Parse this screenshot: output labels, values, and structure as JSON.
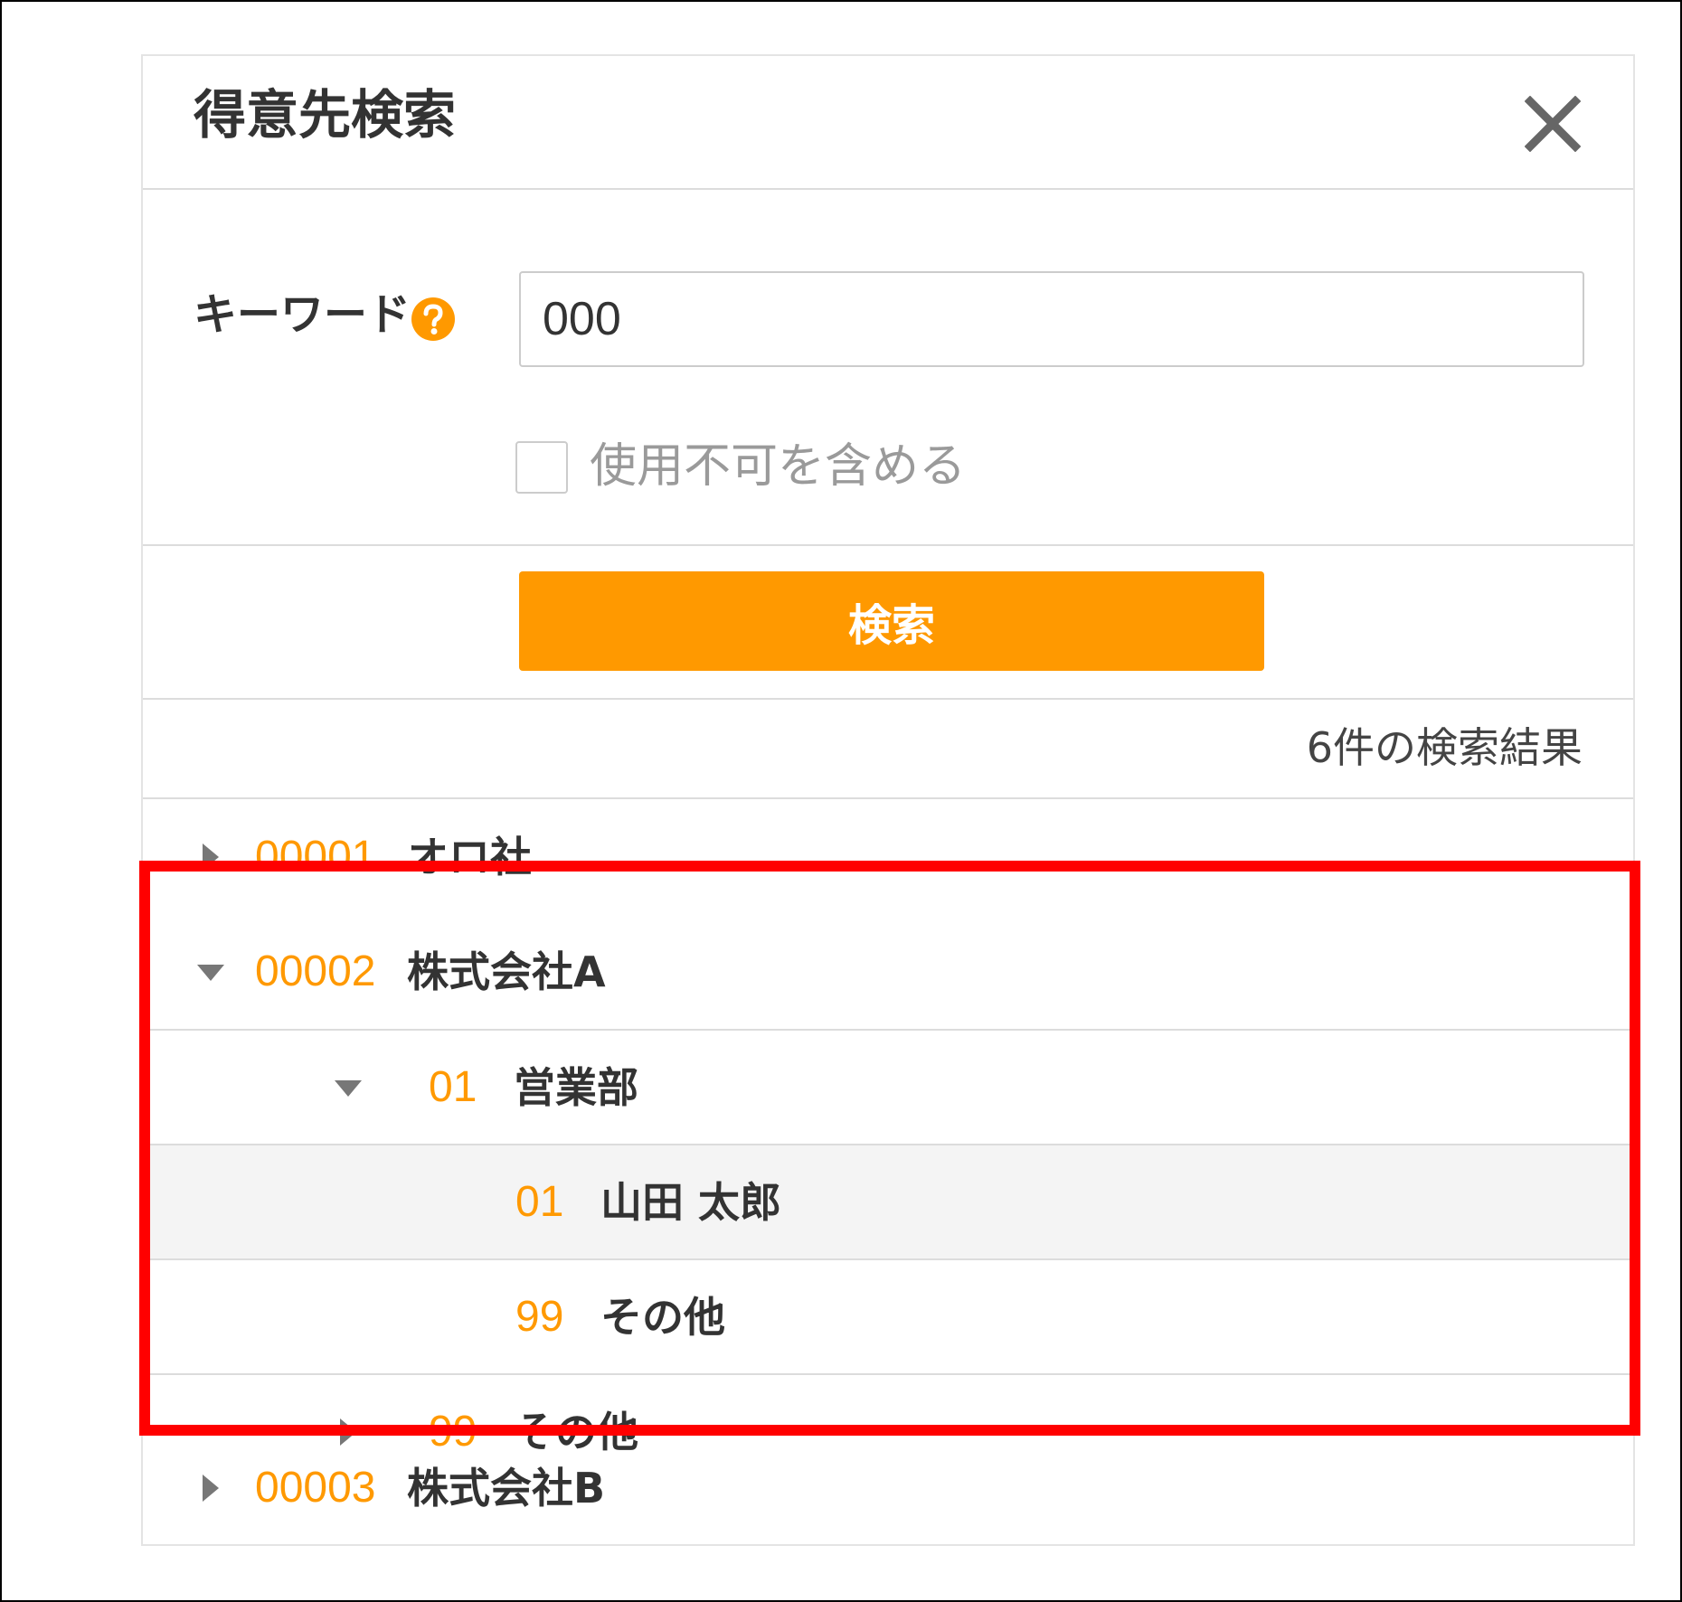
{
  "dialog": {
    "title": "得意先検索",
    "close_icon": "close-icon"
  },
  "form": {
    "keyword_label": "キーワード",
    "keyword_value": "000",
    "help_icon": "question-circle-icon",
    "include_unusable_label": "使用不可を含める",
    "include_unusable_checked": false
  },
  "actions": {
    "search_label": "検索"
  },
  "results": {
    "count_text": "6件の検索結果",
    "rows": [
      {
        "code": "00001",
        "name": "オロ社",
        "level": 0,
        "expanded": false
      },
      {
        "code": "00002",
        "name": "株式会社A",
        "level": 0,
        "expanded": true
      },
      {
        "code": "01",
        "name": "営業部",
        "level": 1,
        "expanded": true
      },
      {
        "code": "01",
        "name": "山田 太郎",
        "level": 2,
        "selected": true
      },
      {
        "code": "99",
        "name": "その他",
        "level": 2
      },
      {
        "code": "99",
        "name": "その他",
        "level": 1,
        "expanded": false
      },
      {
        "code": "00003",
        "name": "株式会社B",
        "level": 0,
        "expanded": false
      }
    ]
  },
  "colors": {
    "accent": "#ff9900",
    "highlight_border": "#ff0000",
    "selected_row_bg": "#f4f4f4"
  }
}
